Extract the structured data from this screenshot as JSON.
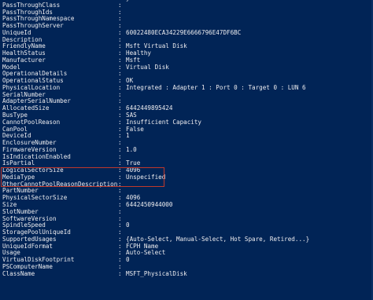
{
  "window": {
    "top_fragment": "}\""
  },
  "properties": [
    {
      "name": "",
      "sep": "",
      "value": "}\""
    },
    {
      "name": "PassThroughClass",
      "sep": ":",
      "value": ""
    },
    {
      "name": "PassThroughIds",
      "sep": ":",
      "value": ""
    },
    {
      "name": "PassThroughNamespace",
      "sep": ":",
      "value": ""
    },
    {
      "name": "PassThroughServer",
      "sep": ":",
      "value": ""
    },
    {
      "name": "UniqueId",
      "sep": ":",
      "value": "60022480ECA34229E6666796E47DF6BC"
    },
    {
      "name": "Description",
      "sep": ":",
      "value": ""
    },
    {
      "name": "FriendlyName",
      "sep": ":",
      "value": "Msft Virtual Disk"
    },
    {
      "name": "HealthStatus",
      "sep": ":",
      "value": "Healthy"
    },
    {
      "name": "Manufacturer",
      "sep": ":",
      "value": "Msft"
    },
    {
      "name": "Model",
      "sep": ":",
      "value": "Virtual Disk"
    },
    {
      "name": "OperationalDetails",
      "sep": ":",
      "value": ""
    },
    {
      "name": "OperationalStatus",
      "sep": ":",
      "value": "OK"
    },
    {
      "name": "PhysicalLocation",
      "sep": ":",
      "value": "Integrated : Adapter 1 : Port 0 : Target 0 : LUN 6"
    },
    {
      "name": "SerialNumber",
      "sep": ":",
      "value": ""
    },
    {
      "name": "AdapterSerialNumber",
      "sep": ":",
      "value": ""
    },
    {
      "name": "AllocatedSize",
      "sep": ":",
      "value": "6442449895424"
    },
    {
      "name": "BusType",
      "sep": ":",
      "value": "SAS"
    },
    {
      "name": "CannotPoolReason",
      "sep": ":",
      "value": "Insufficient Capacity"
    },
    {
      "name": "CanPool",
      "sep": ":",
      "value": "False"
    },
    {
      "name": "DeviceId",
      "sep": ":",
      "value": "1"
    },
    {
      "name": "EnclosureNumber",
      "sep": ":",
      "value": ""
    },
    {
      "name": "FirmwareVersion",
      "sep": ":",
      "value": "1.0"
    },
    {
      "name": "IsIndicationEnabled",
      "sep": ":",
      "value": ""
    },
    {
      "name": "IsPartial",
      "sep": ":",
      "value": "True"
    },
    {
      "name": "LogicalSectorSize",
      "sep": ":",
      "value": "4096"
    },
    {
      "name": "MediaType",
      "sep": ":",
      "value": "Unspecified"
    },
    {
      "name": "OtherCannotPoolReasonDescription",
      "sep": ":",
      "value": ""
    },
    {
      "name": "PartNumber",
      "sep": ":",
      "value": ""
    },
    {
      "name": "PhysicalSectorSize",
      "sep": ":",
      "value": "4096"
    },
    {
      "name": "Size",
      "sep": ":",
      "value": "6442450944000"
    },
    {
      "name": "SlotNumber",
      "sep": ":",
      "value": ""
    },
    {
      "name": "SoftwareVersion",
      "sep": ":",
      "value": ""
    },
    {
      "name": "SpindleSpeed",
      "sep": ":",
      "value": "0"
    },
    {
      "name": "StoragePoolUniqueId",
      "sep": ":",
      "value": ""
    },
    {
      "name": "SupportedUsages",
      "sep": ":",
      "value": "{Auto-Select, Manual-Select, Hot Spare, Retired...}"
    },
    {
      "name": "UniqueIdFormat",
      "sep": ":",
      "value": "FCPH Name"
    },
    {
      "name": "Usage",
      "sep": ":",
      "value": "Auto-Select"
    },
    {
      "name": "VirtualDiskFootprint",
      "sep": ":",
      "value": "0"
    },
    {
      "name": "PSComputerName",
      "sep": ":",
      "value": ""
    },
    {
      "name": "ClassName",
      "sep": ":",
      "value": "MSFT_PhysicalDisk"
    }
  ],
  "highlight": {
    "rows": [
      "IsPartial",
      "LogicalSectorSize",
      "MediaType"
    ],
    "color": "#c0392b"
  },
  "colors": {
    "background": "#012456",
    "text": "#eeedf0"
  }
}
